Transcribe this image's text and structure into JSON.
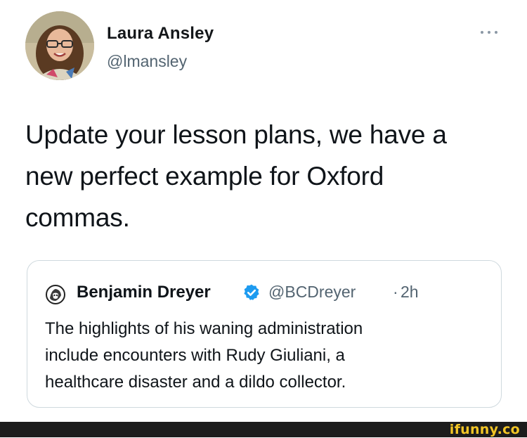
{
  "tweet": {
    "author": {
      "name": "Laura Ansley",
      "handle": "@lmansley"
    },
    "text_lines": [
      "Update your lesson plans, we have a",
      "new perfect example for Oxford",
      "commas."
    ],
    "quoted_tweet": {
      "author": {
        "name": "Benjamin Dreyer",
        "handle": "@BCDreyer",
        "separator": "·",
        "time": "2h"
      },
      "text_lines": [
        "The highlights of his waning administration",
        "include encounters with Rudy Giuliani, a",
        "healthcare disaster and a dildo collector."
      ]
    }
  },
  "watermark": {
    "text": "ifunny.co"
  },
  "icons": {
    "more": "more-options-icon",
    "verified": "verified-badge-icon",
    "avatar_main": "avatar-photo",
    "avatar_quoted": "avatar-illustration"
  },
  "colors": {
    "text_primary": "#0f1419",
    "text_secondary": "#536471",
    "verified_blue": "#1d9bf0",
    "card_border": "#cfd9de",
    "watermark_yellow": "#f2c526",
    "footer_bar": "#1c1c1c"
  }
}
